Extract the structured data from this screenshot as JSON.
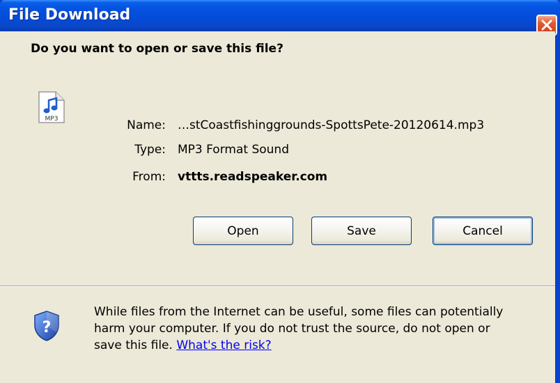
{
  "window": {
    "title": "File Download",
    "close_icon": "close-icon"
  },
  "dialog": {
    "question": "Do you want to open or save this file?",
    "file_icon": "mp3-file-icon",
    "file_icon_text": "MP3",
    "fields": {
      "name_label": "Name:",
      "name_value": "…stCoastfishinggrounds-SpottsPete-20120614.mp3",
      "type_label": "Type:",
      "type_value": "MP3 Format Sound",
      "from_label": "From:",
      "from_value": "vttts.readspeaker.com"
    },
    "buttons": {
      "open": "Open",
      "save": "Save",
      "cancel": "Cancel"
    },
    "warning": {
      "icon": "security-shield-icon",
      "line1": "While files from the Internet can be useful, some files can potentially",
      "line2": "harm your computer. If you do not trust the source, do not open or",
      "line3_prefix": "save this file. ",
      "link": "What's the risk?"
    }
  },
  "colors": {
    "titlebar": "#0551e0",
    "dialog_background": "#ece9d8",
    "close_button": "#e2582f",
    "link": "#0000ee"
  }
}
